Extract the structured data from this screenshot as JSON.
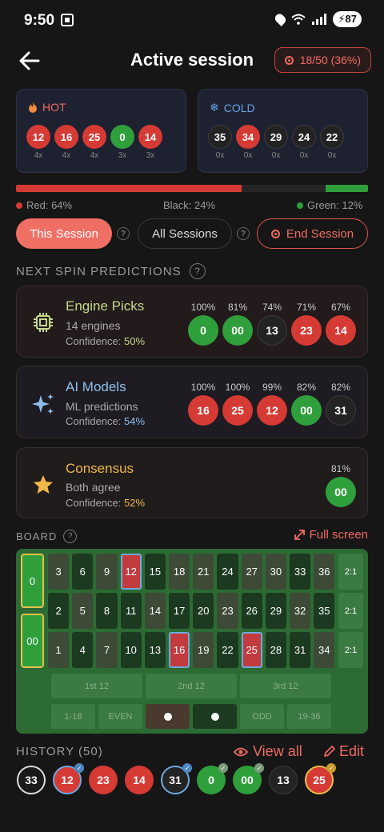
{
  "status": {
    "time": "9:50",
    "battery": "87"
  },
  "header": {
    "title": "Active session",
    "score": "18/50 (36%)"
  },
  "hot": {
    "label": "HOT",
    "numbers": [
      {
        "n": "12",
        "c": "red",
        "cnt": "4x"
      },
      {
        "n": "16",
        "c": "red",
        "cnt": "4x"
      },
      {
        "n": "25",
        "c": "red",
        "cnt": "4x"
      },
      {
        "n": "0",
        "c": "green",
        "cnt": "3x"
      },
      {
        "n": "14",
        "c": "red",
        "cnt": "3x"
      }
    ]
  },
  "cold": {
    "label": "COLD",
    "numbers": [
      {
        "n": "35",
        "c": "black",
        "cnt": "0x"
      },
      {
        "n": "34",
        "c": "red",
        "cnt": "0x"
      },
      {
        "n": "29",
        "c": "black",
        "cnt": "0x"
      },
      {
        "n": "24",
        "c": "black",
        "cnt": "0x"
      },
      {
        "n": "22",
        "c": "black",
        "cnt": "0x"
      }
    ]
  },
  "distribution": {
    "red_label": "Red: 64%",
    "black_label": "Black: 24%",
    "green_label": "Green: 12%",
    "red": 0.64,
    "black": 0.24,
    "green": 0.12,
    "colors": {
      "red": "#d63a34",
      "black": "#262626",
      "green": "#2f9f3c"
    }
  },
  "tabs": {
    "this_session": "This Session",
    "all_sessions": "All Sessions",
    "end_session": "End Session"
  },
  "predictions_title": "NEXT SPIN PREDICTIONS",
  "predictions": [
    {
      "name": "Engine Picks",
      "sub": "14 engines",
      "conf_label": "Confidence: ",
      "conf": "50%",
      "icon": "chip-icon",
      "name_color": "#c6d98a",
      "picks": [
        {
          "pct": "100%",
          "n": "0",
          "c": "green"
        },
        {
          "pct": "81%",
          "n": "00",
          "c": "green"
        },
        {
          "pct": "74%",
          "n": "13",
          "c": "black"
        },
        {
          "pct": "71%",
          "n": "23",
          "c": "red"
        },
        {
          "pct": "67%",
          "n": "14",
          "c": "red"
        }
      ]
    },
    {
      "name": "AI Models",
      "sub": "ML predictions",
      "conf_label": "Confidence: ",
      "conf": "54%",
      "icon": "sparkle-icon",
      "name_color": "#8ec0ea",
      "picks": [
        {
          "pct": "100%",
          "n": "16",
          "c": "red"
        },
        {
          "pct": "100%",
          "n": "25",
          "c": "red"
        },
        {
          "pct": "99%",
          "n": "12",
          "c": "red"
        },
        {
          "pct": "82%",
          "n": "00",
          "c": "green"
        },
        {
          "pct": "82%",
          "n": "31",
          "c": "black"
        }
      ]
    },
    {
      "name": "Consensus",
      "sub": "Both agree",
      "conf_label": "Confidence: ",
      "conf": "52%",
      "icon": "star-icon",
      "name_color": "#f0b84a",
      "picks": [
        {
          "pct": "81%",
          "n": "00",
          "c": "green"
        }
      ]
    }
  ],
  "board": {
    "label": "BOARD",
    "full_screen": "Full screen",
    "zeros": [
      "0",
      "00"
    ],
    "rows": [
      [
        "3",
        "6",
        "9",
        "12",
        "15",
        "18",
        "21",
        "24",
        "27",
        "30",
        "33",
        "36"
      ],
      [
        "2",
        "5",
        "8",
        "11",
        "14",
        "17",
        "20",
        "23",
        "26",
        "29",
        "32",
        "35"
      ],
      [
        "1",
        "4",
        "7",
        "10",
        "13",
        "16",
        "19",
        "22",
        "25",
        "28",
        "31",
        "34"
      ]
    ],
    "column_bets": [
      "2:1",
      "2:1",
      "2:1"
    ],
    "dozens": [
      "1st 12",
      "2nd 12",
      "3rd 12"
    ],
    "outside": [
      "1-18",
      "EVEN",
      "",
      "",
      "ODD",
      "19-36"
    ],
    "highlighted": [
      "12",
      "16",
      "25"
    ],
    "red_numbers": [
      "1",
      "3",
      "5",
      "7",
      "9",
      "12",
      "14",
      "16",
      "18",
      "19",
      "21",
      "23",
      "25",
      "27",
      "30",
      "32",
      "34",
      "36"
    ]
  },
  "history": {
    "label": "HISTORY (50)",
    "view_all": "View all",
    "edit": "Edit",
    "items": [
      {
        "n": "33",
        "c": "ringw",
        "chk": ""
      },
      {
        "n": "12",
        "c": "red ringb",
        "chk": "#4e86c4"
      },
      {
        "n": "23",
        "c": "red",
        "chk": ""
      },
      {
        "n": "14",
        "c": "red",
        "chk": ""
      },
      {
        "n": "31",
        "c": "black ringb",
        "chk": "#4e86c4"
      },
      {
        "n": "0",
        "c": "green",
        "chk": "#7a9a7a"
      },
      {
        "n": "00",
        "c": "green",
        "chk": "#7a9a7a"
      },
      {
        "n": "13",
        "c": "black",
        "chk": ""
      },
      {
        "n": "25",
        "c": "red ringy",
        "chk": "#c99a2a"
      }
    ]
  }
}
